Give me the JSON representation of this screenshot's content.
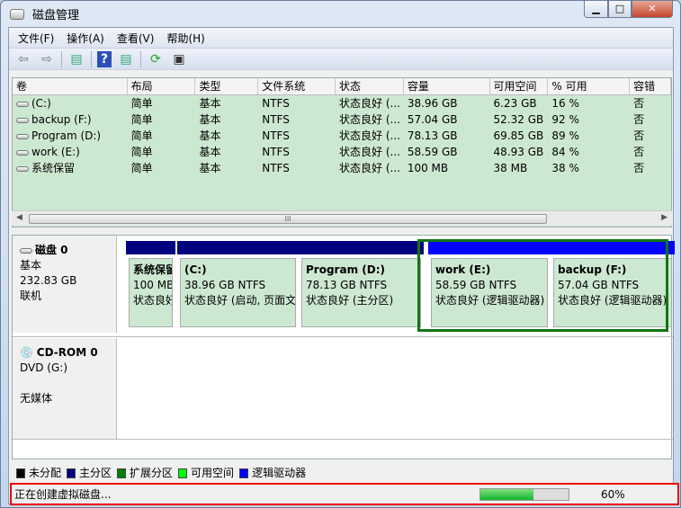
{
  "window": {
    "title": "磁盘管理",
    "minimize": "▁",
    "maximize": "□",
    "close": "✕"
  },
  "menu": [
    "文件(F)",
    "操作(A)",
    "查看(V)",
    "帮助(H)"
  ],
  "toolbar": {
    "icons": [
      "back-arrow-icon",
      "forward-arrow-icon",
      "console-tree-icon",
      "help-icon",
      "action-pane-icon",
      "refresh-icon",
      "properties-icon"
    ]
  },
  "columns": [
    "卷",
    "布局",
    "类型",
    "文件系统",
    "状态",
    "容量",
    "可用空间",
    "% 可用",
    "容错"
  ],
  "volumes": [
    [
      "(C:)",
      "简单",
      "基本",
      "NTFS",
      "状态良好 (...",
      "38.96 GB",
      "6.23 GB",
      "16 %",
      "否"
    ],
    [
      "backup (F:)",
      "简单",
      "基本",
      "NTFS",
      "状态良好 (...",
      "57.04 GB",
      "52.32 GB",
      "92 %",
      "否"
    ],
    [
      "Program (D:)",
      "简单",
      "基本",
      "NTFS",
      "状态良好 (...",
      "78.13 GB",
      "69.85 GB",
      "89 %",
      "否"
    ],
    [
      "work (E:)",
      "简单",
      "基本",
      "NTFS",
      "状态良好 (...",
      "58.59 GB",
      "48.93 GB",
      "84 %",
      "否"
    ],
    [
      "系统保留",
      "简单",
      "基本",
      "NTFS",
      "状态良好 (...",
      "100 MB",
      "38 MB",
      "38 %",
      "否"
    ]
  ],
  "scroll_grip": "III",
  "disk0": {
    "name": "磁盘 0",
    "type": "基本",
    "size": "232.83 GB",
    "state": "联机",
    "partitions": [
      {
        "name": "系统保留",
        "size": "100 MB",
        "status": "状态良好",
        "color": "#000080"
      },
      {
        "name": "(C:)",
        "size": "38.96 GB NTFS",
        "status": "状态良好 (启动, 页面文件",
        "color": "#000080"
      },
      {
        "name": "Program  (D:)",
        "size": "78.13 GB NTFS",
        "status": "状态良好 (主分区)",
        "color": "#000080"
      },
      {
        "name": "work  (E:)",
        "size": "58.59 GB NTFS",
        "status": "状态良好 (逻辑驱动器)",
        "color": "#0000ff"
      },
      {
        "name": "backup  (F:)",
        "size": "57.04 GB NTFS",
        "status": "状态良好 (逻辑驱动器)",
        "color": "#0000ff"
      }
    ]
  },
  "cdrom0": {
    "name": "CD-ROM 0",
    "drive": "DVD (G:)",
    "state": "无媒体"
  },
  "legend": [
    {
      "label": "未分配",
      "color": "#000000"
    },
    {
      "label": "主分区",
      "color": "#000080"
    },
    {
      "label": "扩展分区",
      "color": "#008000"
    },
    {
      "label": "可用空间",
      "color": "#00ff00"
    },
    {
      "label": "逻辑驱动器",
      "color": "#0000ff"
    }
  ],
  "status": {
    "text": "正在创建虚拟磁盘...",
    "progress_percent": 60,
    "progress_label": "60%"
  }
}
